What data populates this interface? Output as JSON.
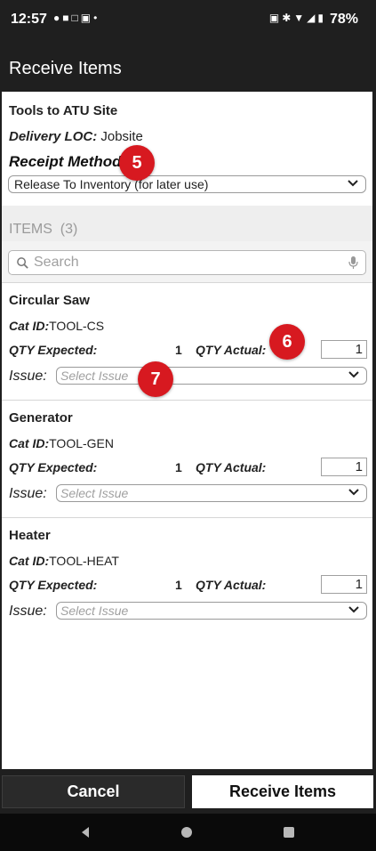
{
  "status_bar": {
    "time": "12:57",
    "left_icons": [
      "chat-icon",
      "teams-icon",
      "calendar-icon",
      "cast-icon",
      "dot-icon"
    ],
    "right_icons": [
      "cast-icon",
      "bluetooth-icon",
      "wifi-icon",
      "signal-icon",
      "battery-icon"
    ],
    "battery": "78%"
  },
  "app_bar": {
    "title": "Receive Items"
  },
  "order": {
    "title": "Tools to ATU Site",
    "delivery_loc_label": "Delivery LOC:",
    "delivery_loc_value": "Jobsite",
    "receipt_method_label": "Receipt Method",
    "receipt_method_value": "Release To Inventory (for later use)"
  },
  "items_section": {
    "label": "ITEMS",
    "count": "(3)",
    "search_placeholder": "Search"
  },
  "items": [
    {
      "name": "Circular Saw",
      "cat_id_label": "Cat ID:",
      "cat_id": "TOOL-CS",
      "qty_expected_label": "QTY Expected:",
      "qty_expected": "1",
      "qty_actual_label": "QTY Actual:",
      "qty_actual": "1",
      "issue_label": "Issue:",
      "issue_placeholder": "Select Issue"
    },
    {
      "name": "Generator",
      "cat_id_label": "Cat ID:",
      "cat_id": "TOOL-GEN",
      "qty_expected_label": "QTY Expected:",
      "qty_expected": "1",
      "qty_actual_label": "QTY Actual:",
      "qty_actual": "1",
      "issue_label": "Issue:",
      "issue_placeholder": "Select Issue"
    },
    {
      "name": "Heater",
      "cat_id_label": "Cat ID:",
      "cat_id": "TOOL-HEAT",
      "qty_expected_label": "QTY Expected:",
      "qty_expected": "1",
      "qty_actual_label": "QTY Actual:",
      "qty_actual": "1",
      "issue_label": "Issue:",
      "issue_placeholder": "Select Issue"
    }
  ],
  "callouts": {
    "receipt_method": "5",
    "qty_actual": "6",
    "issue": "7"
  },
  "footer": {
    "cancel_label": "Cancel",
    "receive_label": "Receive Items"
  },
  "nav_icons": [
    "back-icon",
    "home-icon",
    "recents-icon"
  ],
  "colors": {
    "chrome_background": "#1f1f1f",
    "callout_red": "#d71920",
    "band_gray": "#eeeeee",
    "primary_button": "#ffffff"
  }
}
